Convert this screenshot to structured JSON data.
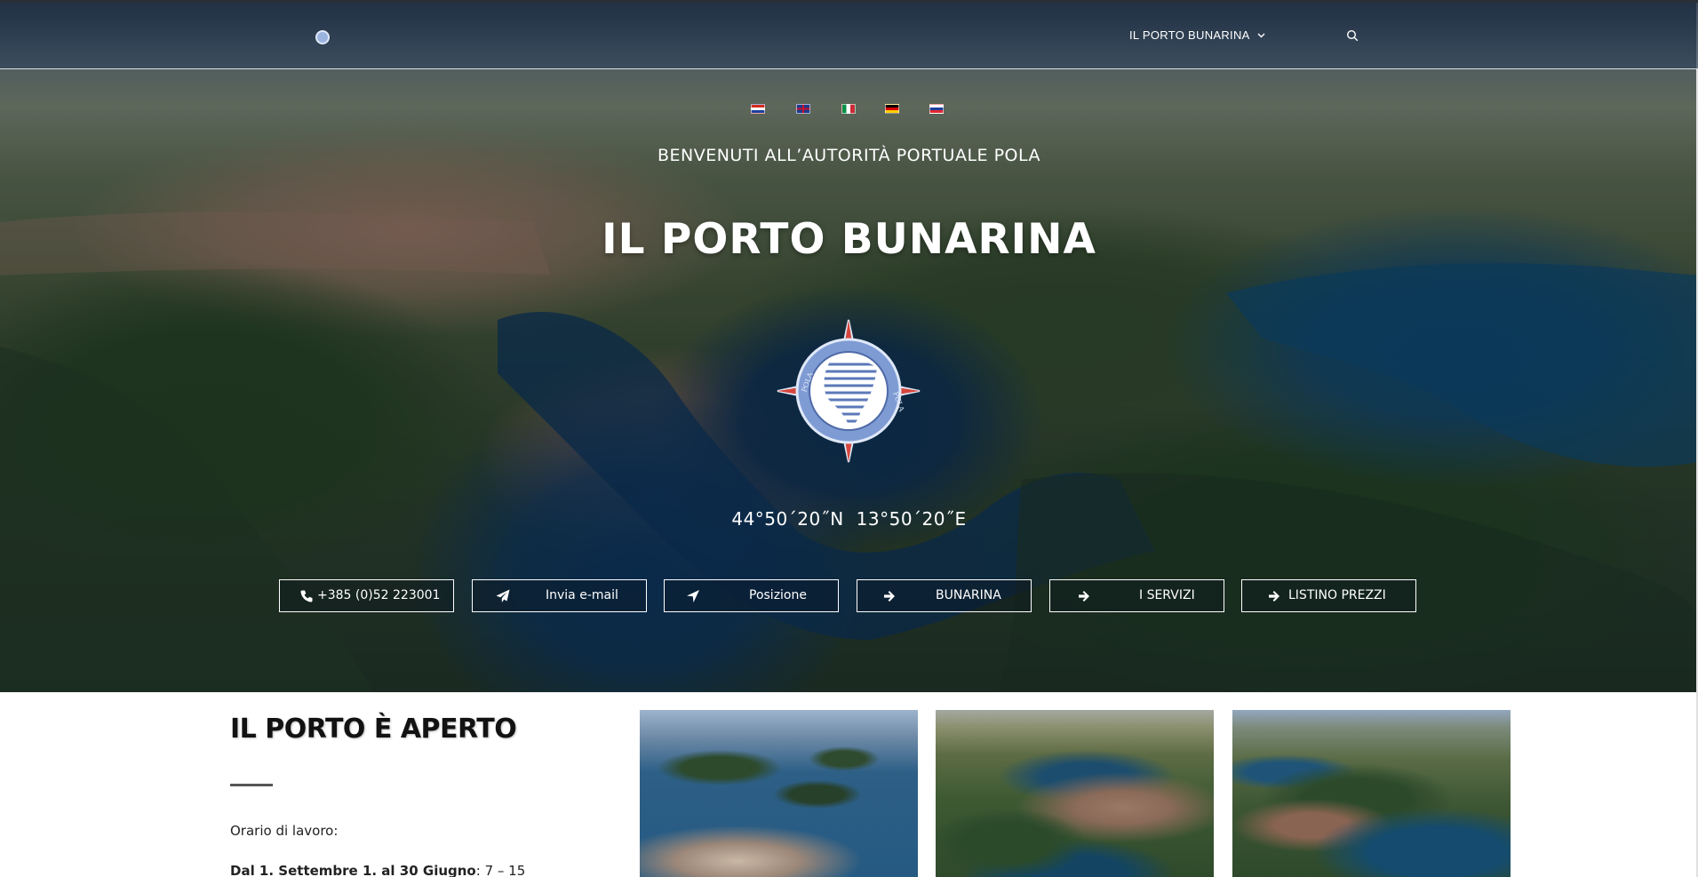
{
  "nav": {
    "menu_label": "IL PORTO BUNARINA",
    "menu_icon": "chevron-down-icon",
    "search_icon": "search-icon"
  },
  "languages": [
    "Hrvatski",
    "English",
    "Italiano",
    "Deutsch",
    "Slovenščina"
  ],
  "hero": {
    "subtitle": "BENVENUTI ALL’AUTORITÀ PORTUALE POLA",
    "title": "IL PORTO BUNARINA",
    "emblem_text_left": "POLA",
    "emblem_text_right": "PULA",
    "latitude": "44°50´20˝N",
    "longitude": "13°50´20˝E",
    "buttons": [
      {
        "label": "+385 (0)52 223001",
        "icon": "phone-icon"
      },
      {
        "label": "Invia e-mail",
        "icon": "paper-plane-icon"
      },
      {
        "label": "Posizione",
        "icon": "location-arrow-icon"
      },
      {
        "label": "BUNARINA",
        "icon": "arrow-right-icon"
      },
      {
        "label": "I SERVIZI",
        "icon": "arrow-right-icon"
      },
      {
        "label": "LISTINO PREZZI",
        "icon": "arrow-right-icon"
      }
    ]
  },
  "status": {
    "title": "IL PORTO È APERTO",
    "hours_label": "Orario di lavoro:",
    "hours_period": "Dal 1. Settembre 1.  al 30 Giugno",
    "hours_time": ": 7 – 15"
  },
  "colors": {
    "accent_emblem": "#8fa9dc",
    "emblem_red": "#d6453b",
    "text_dark": "#121212"
  }
}
